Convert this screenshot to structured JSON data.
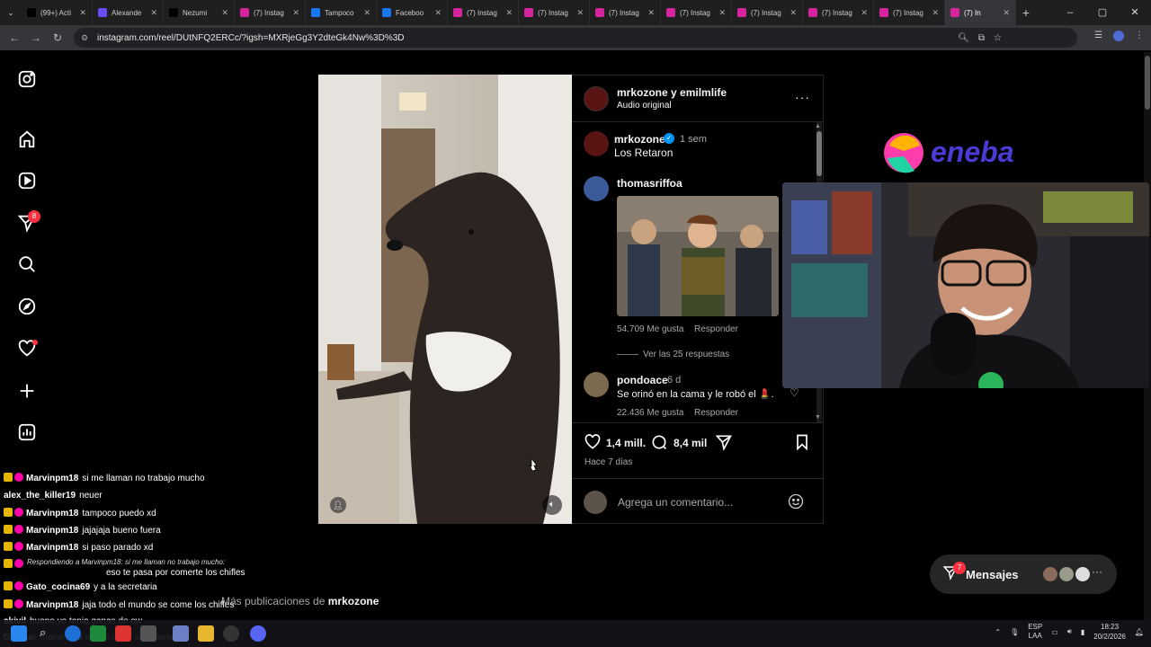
{
  "browser": {
    "tabs": [
      {
        "label": "(99+) Acti",
        "color": "#000000"
      },
      {
        "label": "Alexande",
        "color": "#6a4cff"
      },
      {
        "label": "Nezumi",
        "color": "#000000"
      },
      {
        "label": "(7) Instag",
        "color": "#d6249f"
      },
      {
        "label": "Tampoco",
        "color": "#1877f2"
      },
      {
        "label": "Faceboo",
        "color": "#1877f2"
      },
      {
        "label": "(7) Instag",
        "color": "#d6249f"
      },
      {
        "label": "(7) Instag",
        "color": "#d6249f"
      },
      {
        "label": "(7) Instag",
        "color": "#d6249f"
      },
      {
        "label": "(7) Instag",
        "color": "#d6249f"
      },
      {
        "label": "(7) Instag",
        "color": "#d6249f"
      },
      {
        "label": "(7) Instag",
        "color": "#d6249f"
      },
      {
        "label": "(7) Instag",
        "color": "#d6249f"
      },
      {
        "label": "(7) In",
        "color": "#d6249f"
      }
    ],
    "url": "instagram.com/reel/DUtNFQ2ERCc/?igsh=MXRjeGg3Y2dteGk4Nw%3D%3D"
  },
  "sidebar": {
    "notifications_badge": "8"
  },
  "post": {
    "header_user": "mrkozone y emilmlife",
    "header_audio": "Audio original",
    "caption_user": "mrkozone",
    "caption_time": "1 sem",
    "caption_text": "Los Retaron",
    "comments": [
      {
        "user": "thomasriffoa",
        "likes": "54.709 Me gusta",
        "reply": "Responder"
      },
      {
        "user": "pondoace",
        "time": "6 d",
        "text": "Se orinó en la cama y le robó el 💄.",
        "likes": "22.436 Me gusta",
        "reply": "Responder"
      }
    ],
    "view_replies": "Ver las 25 respuestas",
    "likes_count": "1,4 mill.",
    "comments_count": "8,4 mil",
    "posted_ago": "Hace 7 días",
    "comment_placeholder": "Agrega un comentario..."
  },
  "more_posts_prefix": "Más publicaciones de",
  "more_posts_user": "mrkozone",
  "messages": {
    "label": "Mensajes",
    "badge": "7"
  },
  "overlay": {
    "eneba_logo": "eneba"
  },
  "chat": [
    {
      "user": "Marvinpm18",
      "text": "si me llaman no trabajo mucho"
    },
    {
      "user": "alex_the_killer19",
      "text": "neuer"
    },
    {
      "user": "Marvinpm18",
      "text": "tampoco puedo xd"
    },
    {
      "user": "Marvinpm18",
      "text": "jajajaja bueno fuera"
    },
    {
      "user": "Marvinpm18",
      "text": "si paso parado xd"
    },
    {
      "user": "Gato_cocina69",
      "reply_to": "Respondiendo a Marvinpm18: si me llaman no trabajo mucho:",
      "text": "eso te pasa por comerte los chifles"
    },
    {
      "user": "Gato_cocina69",
      "text": "y a la secretaria"
    },
    {
      "user": "Marvinpm18",
      "text": "jaja todo el mundo se come los chifles"
    },
    {
      "user": "akivil",
      "text": "bueno yo tenia ganas de ow"
    },
    {
      "user": "Daxtaar",
      "text": "marvin era el que tenia secretaria?"
    }
  ],
  "tray": {
    "lang1": "ESP",
    "lang2": "LAA",
    "time": "18:23",
    "date": "20/2/2026"
  }
}
